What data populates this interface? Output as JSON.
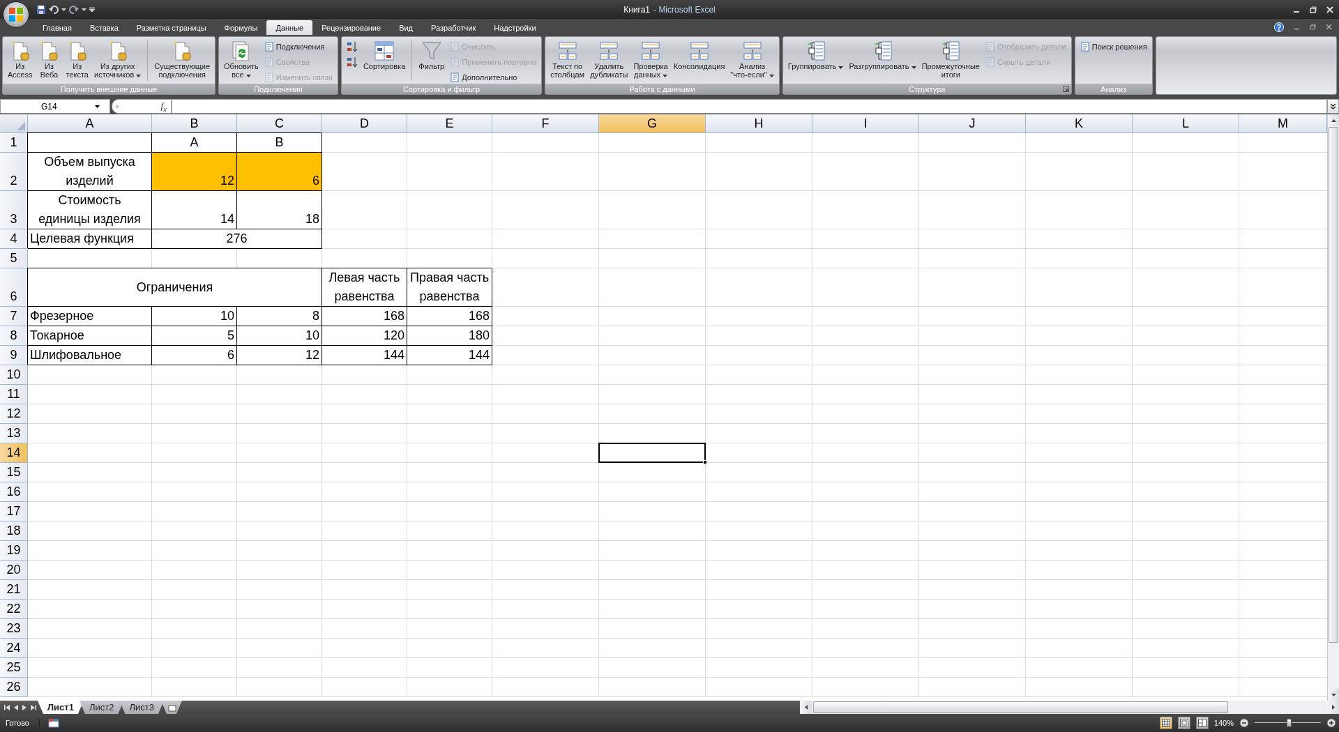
{
  "window": {
    "title": "Книга1",
    "app": "- Microsoft Excel"
  },
  "tabs": [
    {
      "label": "Главная",
      "selected": false
    },
    {
      "label": "Вставка",
      "selected": false
    },
    {
      "label": "Разметка страницы",
      "selected": false
    },
    {
      "label": "Формулы",
      "selected": false
    },
    {
      "label": "Данные",
      "selected": true
    },
    {
      "label": "Рецензирование",
      "selected": false
    },
    {
      "label": "Вид",
      "selected": false
    },
    {
      "label": "Разработчик",
      "selected": false
    },
    {
      "label": "Надстройки",
      "selected": false
    }
  ],
  "ribbon": {
    "groups": [
      {
        "label": "Получить внешние данные",
        "launcher": false,
        "buttons": [
          {
            "kind": "large",
            "lines": [
              "Из",
              "Access"
            ],
            "dropdown": false
          },
          {
            "kind": "large",
            "lines": [
              "Из",
              "Веба"
            ],
            "dropdown": false
          },
          {
            "kind": "large",
            "lines": [
              "Из",
              "текста"
            ],
            "dropdown": false
          },
          {
            "kind": "large",
            "lines": [
              "Из других",
              "источников"
            ],
            "dropdown": true
          },
          {
            "kind": "separator"
          },
          {
            "kind": "large",
            "lines": [
              "Существующие",
              "подключения"
            ],
            "dropdown": false
          }
        ]
      },
      {
        "label": "Подключения",
        "launcher": false,
        "buttons": [
          {
            "kind": "large",
            "lines": [
              "Обновить",
              "все"
            ],
            "dropdown": true
          },
          {
            "kind": "stack",
            "items": [
              {
                "label": "Подключения",
                "disabled": false
              },
              {
                "label": "Свойства",
                "disabled": true
              },
              {
                "label": "Изменить связи",
                "disabled": true
              }
            ]
          }
        ]
      },
      {
        "label": "Сортировка и фильтр",
        "launcher": false,
        "buttons": [
          {
            "kind": "stack",
            "items": [
              {
                "disabled": false
              },
              {
                "disabled": false
              }
            ]
          },
          {
            "kind": "large",
            "lines": [
              "Сортировка"
            ],
            "dropdown": false
          },
          {
            "kind": "separator"
          },
          {
            "kind": "large",
            "lines": [
              "Фильтр"
            ],
            "dropdown": false
          },
          {
            "kind": "stack",
            "items": [
              {
                "label": "Очистить",
                "disabled": true
              },
              {
                "label": "Применить повторно",
                "disabled": true
              },
              {
                "label": "Дополнительно",
                "disabled": false
              }
            ]
          }
        ]
      },
      {
        "label": "Работа с данными",
        "launcher": false,
        "buttons": [
          {
            "kind": "large",
            "lines": [
              "Текст по",
              "столбцам"
            ],
            "dropdown": false
          },
          {
            "kind": "large",
            "lines": [
              "Удалить",
              "дубликаты"
            ],
            "dropdown": false
          },
          {
            "kind": "large",
            "lines": [
              "Проверка",
              "данных"
            ],
            "dropdown": true
          },
          {
            "kind": "large",
            "lines": [
              "Консолидация"
            ],
            "dropdown": false
          },
          {
            "kind": "large",
            "lines": [
              "Анализ",
              "\"что-если\""
            ],
            "dropdown": true
          }
        ]
      },
      {
        "label": "Структура",
        "launcher": true,
        "buttons": [
          {
            "kind": "large",
            "lines": [
              "Группировать"
            ],
            "dropdown": true
          },
          {
            "kind": "large",
            "lines": [
              "Разгруппировать"
            ],
            "dropdown": true
          },
          {
            "kind": "large",
            "lines": [
              "Промежуточные",
              "итоги"
            ],
            "dropdown": false
          },
          {
            "kind": "stack",
            "items": [
              {
                "label": "Отобразить детали",
                "disabled": true
              },
              {
                "label": "Скрыть детали",
                "disabled": true
              }
            ]
          }
        ]
      },
      {
        "label": "Анализ",
        "launcher": false,
        "buttons": [
          {
            "kind": "stack",
            "items": [
              {
                "label": "Поиск решения",
                "disabled": false
              }
            ]
          }
        ]
      }
    ]
  },
  "formula_bar": {
    "name_box": "G14",
    "fx": "f$_{x}$"
  },
  "columns": [
    {
      "label": "A",
      "selected": false
    },
    {
      "label": "B",
      "selected": false
    },
    {
      "label": "C",
      "selected": false
    },
    {
      "label": "D",
      "selected": false
    },
    {
      "label": "E",
      "selected": false
    },
    {
      "label": "F",
      "selected": false
    },
    {
      "label": "G",
      "selected": true
    },
    {
      "label": "H",
      "selected": false
    },
    {
      "label": "I",
      "selected": false
    },
    {
      "label": "J",
      "selected": false
    },
    {
      "label": "K",
      "selected": false
    },
    {
      "label": "L",
      "selected": false
    },
    {
      "label": "M",
      "selected": false
    }
  ],
  "rows": [
    {
      "label": "1",
      "selected": false,
      "cells": [
        {
          "kind": "empty",
          "bordered": true
        },
        {
          "kind": "centered",
          "text": "A",
          "bordered": true
        },
        {
          "kind": "centered",
          "text": "B",
          "bordered": true
        }
      ]
    },
    {
      "label": "2",
      "selected": false,
      "cells": [
        {
          "kind": "centered",
          "text": "Объем выпуска\nизделий",
          "bordered": true
        },
        {
          "kind": "number",
          "text": "12",
          "bordered": true,
          "color": "#ffc000"
        },
        {
          "kind": "number",
          "text": "6",
          "bordered": true,
          "color": "#ffc000"
        }
      ]
    },
    {
      "label": "3",
      "selected": false,
      "cells": [
        {
          "kind": "centered",
          "text": "Стоимость\nединицы изделия",
          "bordered": true
        },
        {
          "kind": "number",
          "text": "14",
          "bordered": true
        },
        {
          "kind": "number",
          "text": "18",
          "bordered": true
        }
      ]
    },
    {
      "label": "4",
      "selected": false,
      "cells": [
        {
          "kind": "text",
          "text": "Целевая функция",
          "bordered": true
        },
        {
          "kind": "centered",
          "text": "276",
          "bordered": true
        },
        {
          "kind": "covered"
        }
      ]
    },
    {
      "label": "5",
      "selected": false
    },
    {
      "label": "6",
      "selected": false,
      "cells": [
        {
          "kind": "title",
          "text": "Ограничения",
          "bordered": true
        },
        {
          "kind": "covered"
        },
        {
          "kind": "covered"
        },
        {
          "kind": "centered",
          "text": "Левая часть\nравенства",
          "bordered": true
        },
        {
          "kind": "centered",
          "text": "Правая часть\nравенства",
          "bordered": true
        }
      ]
    },
    {
      "label": "7",
      "selected": false,
      "cells": [
        {
          "kind": "text",
          "text": "Фрезерное",
          "bordered": true
        },
        {
          "kind": "number",
          "text": "10",
          "bordered": true
        },
        {
          "kind": "number",
          "text": "8",
          "bordered": true
        },
        {
          "kind": "number",
          "text": "168",
          "bordered": true
        },
        {
          "kind": "number",
          "text": "168",
          "bordered": true
        }
      ]
    },
    {
      "label": "8",
      "selected": false,
      "cells": [
        {
          "kind": "text",
          "text": "Токарное",
          "bordered": true
        },
        {
          "kind": "number",
          "text": "5",
          "bordered": true
        },
        {
          "kind": "number",
          "text": "10",
          "bordered": true
        },
        {
          "kind": "number",
          "text": "120",
          "bordered": true
        },
        {
          "kind": "number",
          "text": "180",
          "bordered": true
        }
      ]
    },
    {
      "label": "9",
      "selected": false,
      "cells": [
        {
          "kind": "text",
          "text": "Шлифовальное",
          "bordered": true
        },
        {
          "kind": "number",
          "text": "6",
          "bordered": true
        },
        {
          "kind": "number",
          "text": "12",
          "bordered": true
        },
        {
          "kind": "number",
          "text": "144",
          "bordered": true
        },
        {
          "kind": "number",
          "text": "144",
          "bordered": true
        }
      ]
    },
    {
      "label": "10",
      "selected": false
    },
    {
      "label": "11",
      "selected": false
    },
    {
      "label": "12",
      "selected": false
    },
    {
      "label": "13",
      "selected": false
    },
    {
      "label": "14",
      "selected": true
    },
    {
      "label": "15",
      "selected": false
    },
    {
      "label": "16",
      "selected": false
    },
    {
      "label": "17",
      "selected": false
    },
    {
      "label": "18",
      "selected": false
    },
    {
      "label": "19",
      "selected": false
    },
    {
      "label": "20",
      "selected": false
    },
    {
      "label": "21",
      "selected": false
    },
    {
      "label": "22",
      "selected": false
    },
    {
      "label": "23",
      "selected": false
    },
    {
      "label": "24",
      "selected": false
    },
    {
      "label": "25",
      "selected": false
    },
    {
      "label": "26",
      "selected": false
    }
  ],
  "sheet_tabs": [
    {
      "label": "Лист1",
      "selected": true
    },
    {
      "label": "Лист2",
      "selected": false
    },
    {
      "label": "Лист3",
      "selected": false
    }
  ],
  "status_bar": {
    "text": "Готово",
    "views": [
      {
        "selected": true
      },
      {
        "selected": false
      },
      {
        "selected": false
      }
    ],
    "zoom": {
      "label": "140%",
      "level": 0.52
    }
  }
}
